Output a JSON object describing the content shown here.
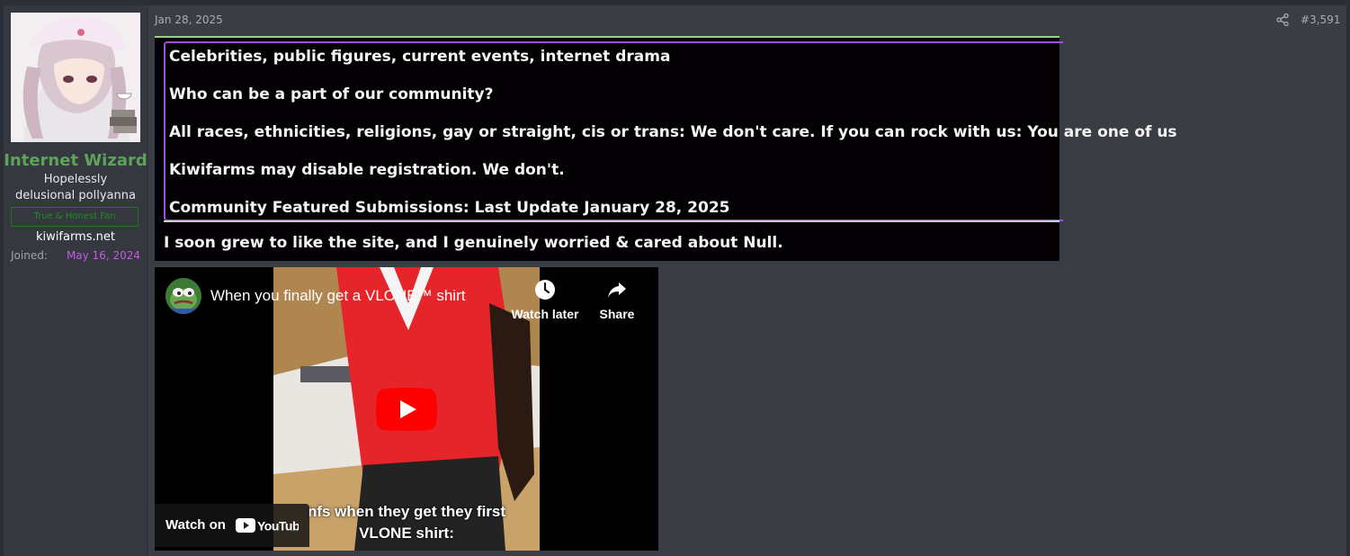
{
  "user": {
    "username": "Internet Wizard",
    "title": "Hopelessly delusional pollyanna",
    "banner": "True & Honest Fan",
    "site": "kiwifarms.net",
    "joined_label": "Joined:",
    "joined_value": "May 16, 2024"
  },
  "post": {
    "date": "Jan 28, 2025",
    "number": "#3,591",
    "quote_lines": [
      "Celebrities, public figures, current events, internet drama",
      "Who can be a part of our community?",
      "All races, ethnicities, religions, gay or straight, cis or trans: We don't care. If you can rock with us: You are one of us",
      "Kiwifarms may disable registration. We don't.",
      "Community Featured Submissions: Last Update January 28, 2025",
      "I soon grew to like the site, and I genuinely worried & cared about Null."
    ]
  },
  "video": {
    "title": "When you finally get a VLONE™ shirt",
    "watch_later": "Watch later",
    "share": "Share",
    "caption_line1": "nfs when they get they first",
    "caption_line2": "VLONE shirt:",
    "watch_on": "Watch on",
    "brand": "YouTube"
  },
  "colors": {
    "username": "#5fa35a",
    "joined": "#c35de0",
    "banner": "#1f8c1f",
    "quote_border": "#a050d8",
    "youtube_red": "#ff0000"
  },
  "icons": [
    "share-icon",
    "clock-icon",
    "share-arrow-icon",
    "play-icon",
    "youtube-logo-icon"
  ]
}
